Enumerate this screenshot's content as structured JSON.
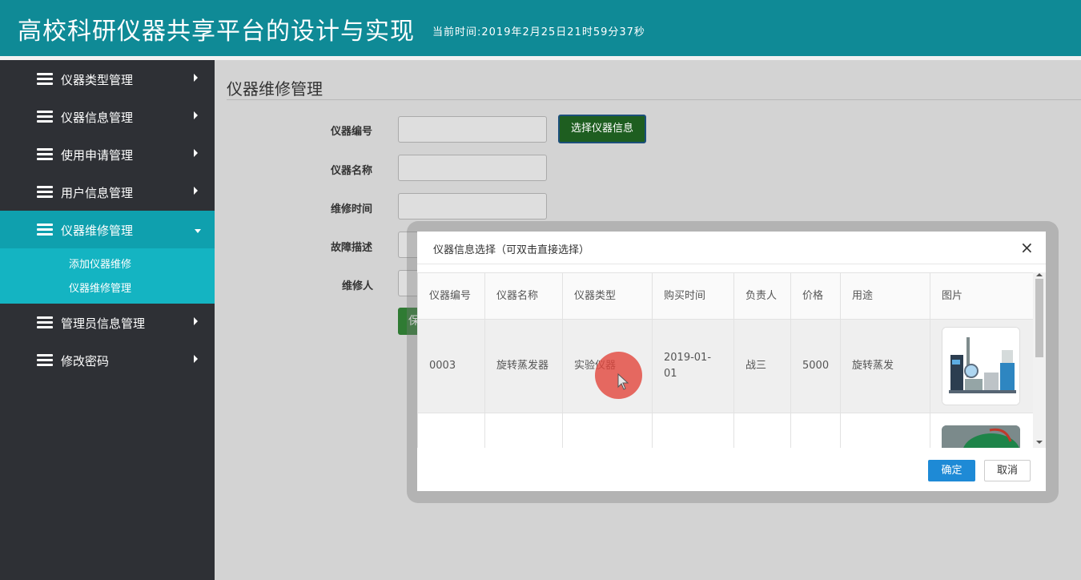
{
  "header": {
    "title": "高校科研仪器共享平台的设计与实现",
    "time": "当前时间:2019年2月25日21时59分37秒"
  },
  "sidebar": {
    "items": [
      {
        "label": "仪器类型管理"
      },
      {
        "label": "仪器信息管理"
      },
      {
        "label": "使用申请管理"
      },
      {
        "label": "用户信息管理"
      },
      {
        "label": "仪器维修管理"
      },
      {
        "label": "管理员信息管理"
      },
      {
        "label": "修改密码"
      }
    ],
    "submenu": [
      {
        "label": "添加仪器维修"
      },
      {
        "label": "仪器维修管理"
      }
    ]
  },
  "main": {
    "title": "仪器维修管理",
    "form": {
      "device_no_label": "仪器编号",
      "device_no_value": "",
      "device_name_label": "仪器名称",
      "device_name_value": "",
      "repair_time_label": "维修时间",
      "repair_time_value": "",
      "fault_label": "故障描述",
      "repairer_label": "维修人",
      "select_button": "选择仪器信息",
      "save_button": "保存"
    }
  },
  "modal": {
    "title": "仪器信息选择（可双击直接选择）",
    "close": "×",
    "columns": [
      "仪器编号",
      "仪器名称",
      "仪器类型",
      "购买时间",
      "负责人",
      "价格",
      "用途",
      "图片"
    ],
    "rows": [
      {
        "no": "0003",
        "name": "旋转蒸发器",
        "type": "实验仪器",
        "date": "2019-01-01",
        "owner": "战三",
        "price": "5000",
        "usage": "旋转蒸发"
      },
      {
        "no": "",
        "name": "",
        "type": "",
        "date": "",
        "owner": "",
        "price": "",
        "usage": ""
      }
    ],
    "ok_button": "确定",
    "cancel_button": "取消"
  },
  "colors": {
    "header": "#0f8a96",
    "sidebar": "#2e3035",
    "active_nav": "#0fa0ae",
    "submenu": "#14b4c2",
    "select_button": "#1e5e20",
    "ok_button": "#1e8ad6"
  },
  "icons": {
    "nav": "layers-icon",
    "arrow": "caret-right-icon",
    "active_arrow": "caret-down-icon",
    "close": "close-icon",
    "cursor": "mouse-pointer-icon"
  }
}
